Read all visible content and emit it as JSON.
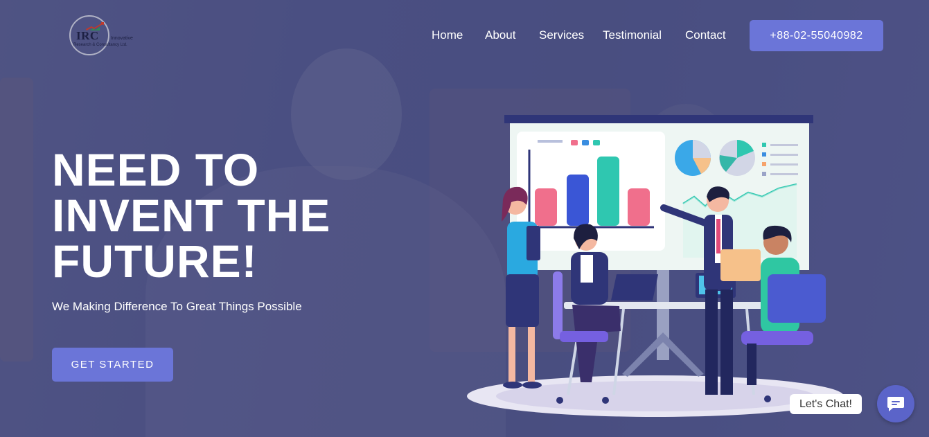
{
  "brand": {
    "logo_mark": "IRC",
    "tagline_line1": "Innovative",
    "tagline_line2": "Research & Consultancy Ltd."
  },
  "nav": {
    "items": [
      {
        "label": "Home"
      },
      {
        "label": "About"
      },
      {
        "label": "Services"
      },
      {
        "label": "Testimonial"
      },
      {
        "label": "Contact"
      }
    ],
    "phone_label": "+88-02-55040982"
  },
  "hero": {
    "headline_line1": "NEED TO",
    "headline_line2": "INVENT THE",
    "headline_line3": "FUTURE!",
    "subtitle": "We Making Difference To Great Things Possible",
    "cta_label": "GET STARTED"
  },
  "chat": {
    "label": "Let's Chat!",
    "icon": "chat-icon"
  },
  "colors": {
    "accent": "#6b75d8",
    "overlay": "#4b5080",
    "text": "#ffffff"
  }
}
